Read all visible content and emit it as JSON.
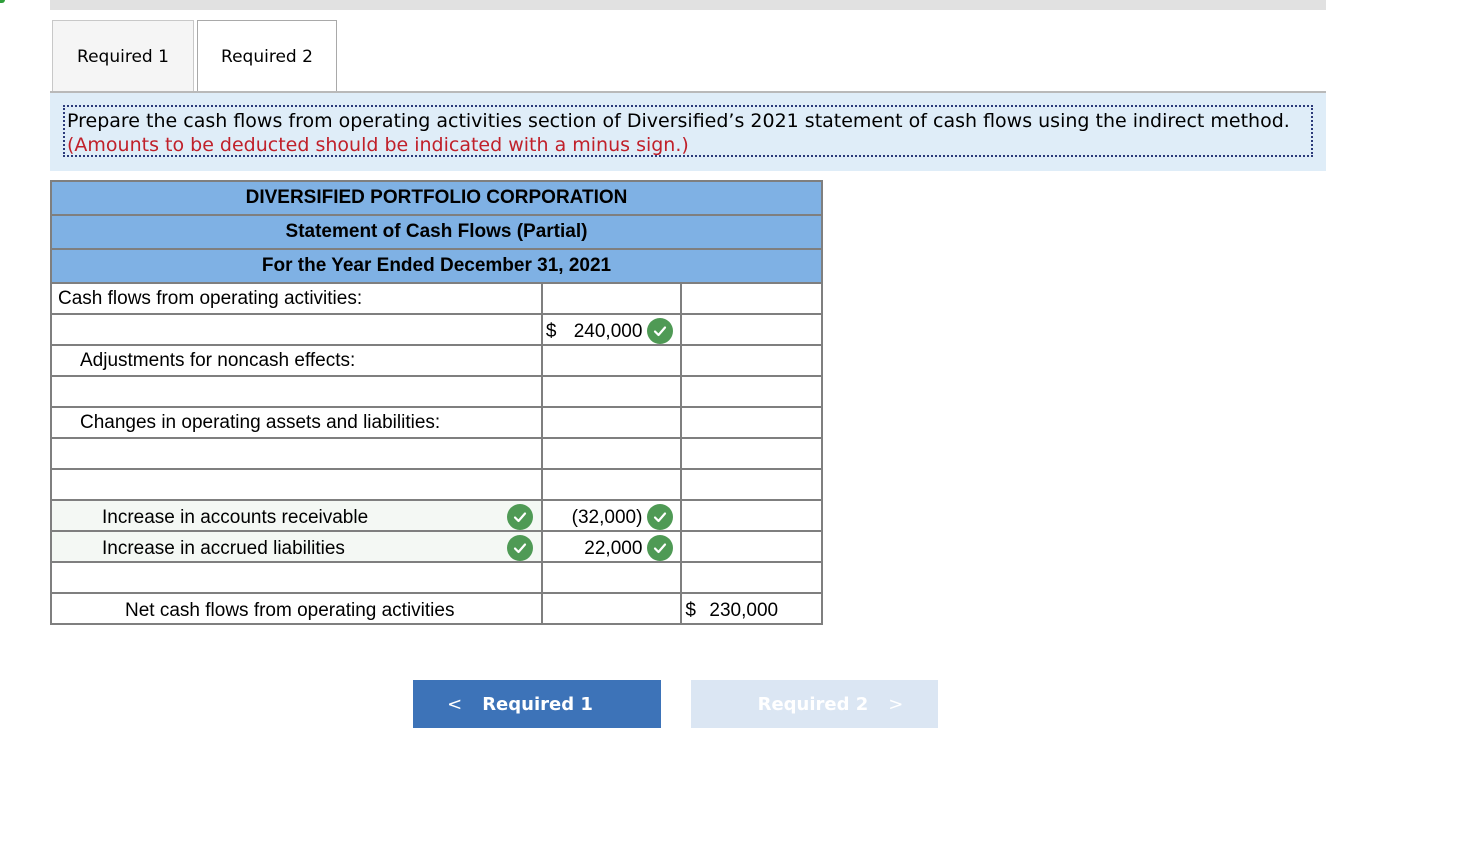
{
  "tabs": [
    {
      "label": "Required 1"
    },
    {
      "label": "Required 2"
    }
  ],
  "instructions": {
    "main": "Prepare the cash flows from operating activities section of Diversified’s 2021 statement of cash flows using the indirect method.",
    "note": "(Amounts to be deducted should be indicated with a minus sign.)"
  },
  "statement": {
    "company": "DIVERSIFIED PORTFOLIO CORPORATION",
    "title": "Statement of Cash Flows (Partial)",
    "period": "For the Year Ended December 31, 2021",
    "rows": {
      "operating_label": "Cash flows from operating activities:",
      "net_income": {
        "currency": "$",
        "amount": "240,000"
      },
      "adjustments_label": "Adjustments for noncash effects:",
      "changes_label": "Changes in operating assets and liabilities:",
      "ar": {
        "label": "Increase in accounts receivable",
        "amount": "(32,000)"
      },
      "accrued": {
        "label": "Increase in accrued liabilities",
        "amount": "22,000"
      },
      "net": {
        "label": "Net cash flows from operating activities",
        "currency": "$",
        "amount": "230,000"
      }
    }
  },
  "nav": {
    "prev_label": "Required 1",
    "next_label": "Required 2",
    "prev_chevron": "<",
    "next_chevron": ">"
  },
  "colors": {
    "header_blue": "#7fb1e4",
    "check_green": "#4f9a55",
    "note_red": "#c0202a",
    "button_blue": "#3d73b8"
  }
}
